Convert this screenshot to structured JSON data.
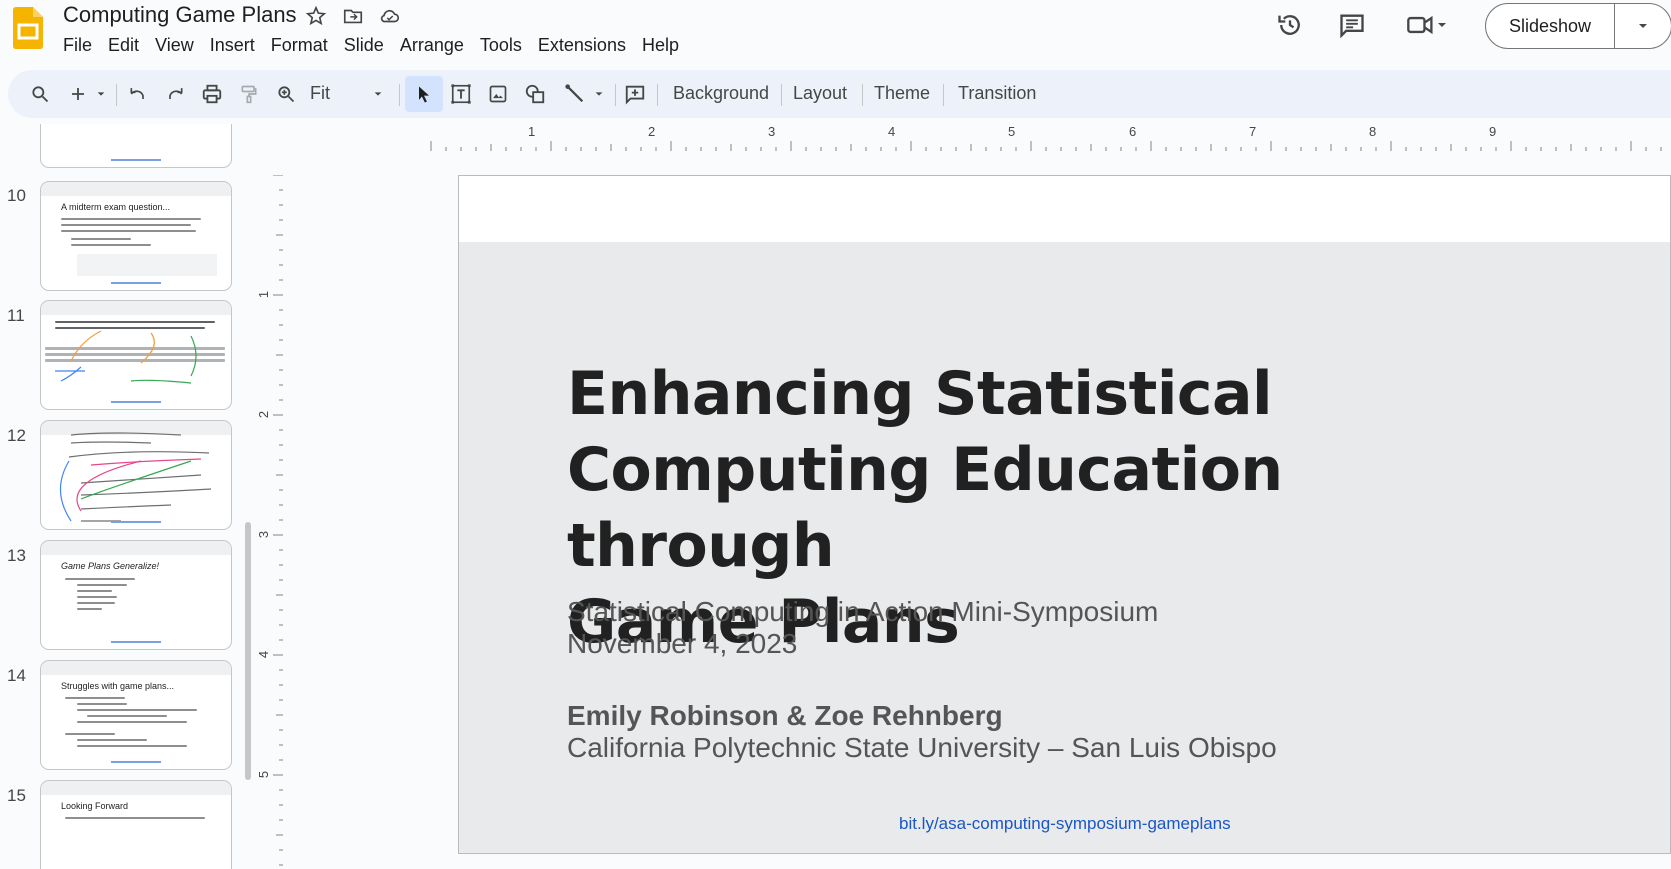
{
  "app": {
    "doc_title": "Computing Game Plans",
    "menu": [
      "File",
      "Edit",
      "View",
      "Insert",
      "Format",
      "Slide",
      "Arrange",
      "Tools",
      "Extensions",
      "Help"
    ],
    "slideshow_label": "Slideshow"
  },
  "toolbar": {
    "zoom_value": "Fit",
    "background_label": "Background",
    "layout_label": "Layout",
    "theme_label": "Theme",
    "transition_label": "Transition"
  },
  "filmstrip": {
    "slides": [
      {
        "number": "10",
        "title": "A midterm exam question..."
      },
      {
        "number": "11",
        "title": ""
      },
      {
        "number": "12",
        "title": ""
      },
      {
        "number": "13",
        "title": "Game Plans Generalize!"
      },
      {
        "number": "14",
        "title": "Struggles with game plans..."
      },
      {
        "number": "15",
        "title": "Looking Forward"
      }
    ]
  },
  "ruler": {
    "horizontal": [
      "1",
      "2",
      "3",
      "4",
      "5",
      "6",
      "7",
      "8",
      "9"
    ],
    "vertical": [
      "1",
      "2",
      "3",
      "4",
      "5"
    ]
  },
  "slide": {
    "title_line1": "Enhancing Statistical",
    "title_line2": "Computing Education through",
    "title_line3": "Game Plans",
    "event": "Statistical Computing in Action Mini-Symposium",
    "date": "November 4, 2023",
    "authors": "Emily Robinson & Zoe Rehnberg",
    "affiliation": "California Polytechnic State University – San Luis Obispo",
    "link": "bit.ly/asa-computing-symposium-gameplans"
  },
  "colors": {
    "accent": "#0b57d0",
    "toolbar_bg": "#edf2fa",
    "slide_bg": "#e8eaeb",
    "logo": "#f4b400"
  }
}
